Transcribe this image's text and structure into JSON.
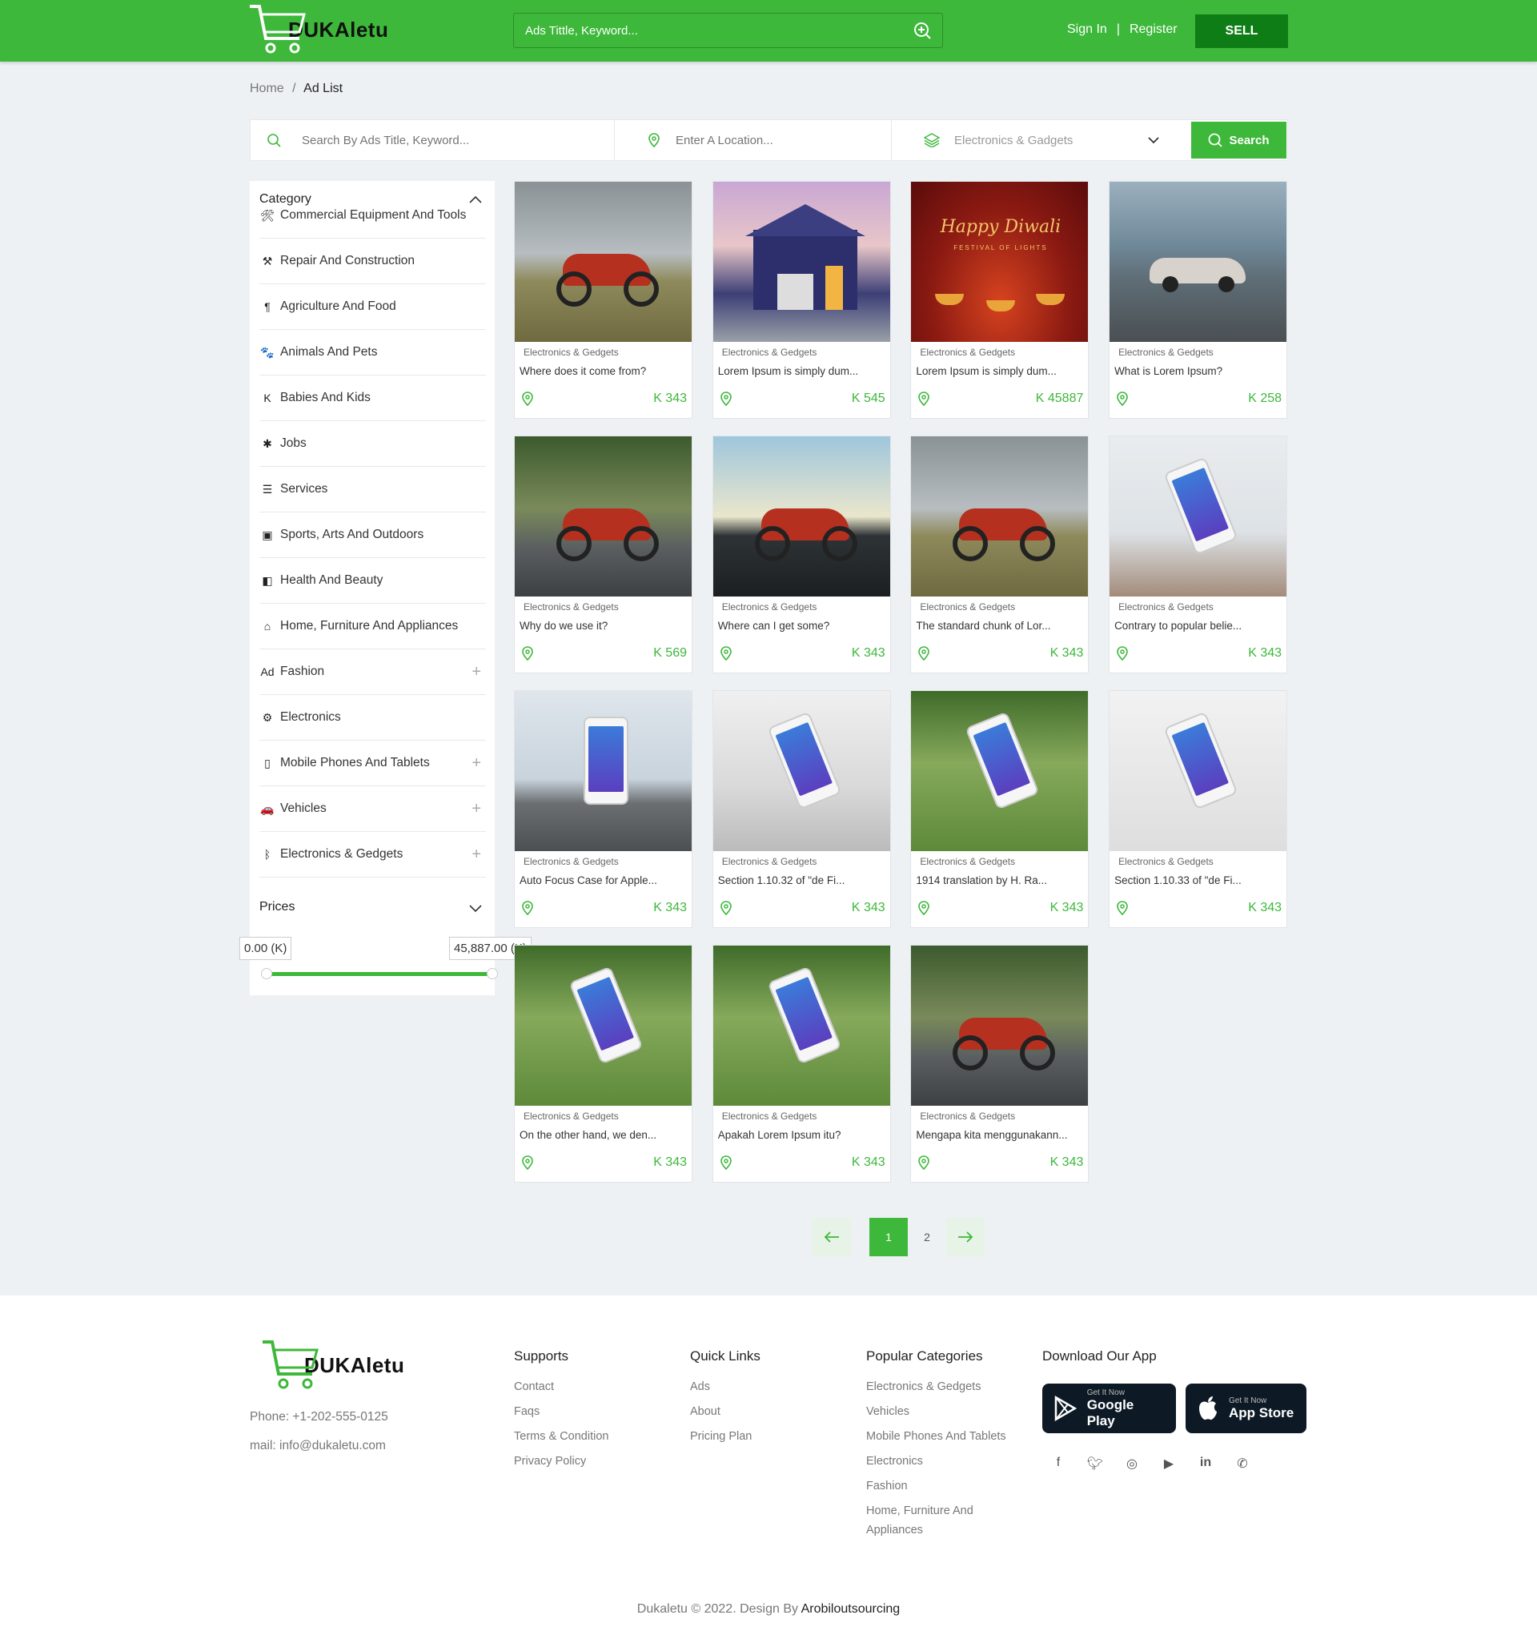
{
  "brand": {
    "logo_text": "DUKAletu"
  },
  "header": {
    "search_placeholder": "Ads Tittle, Keyword...",
    "sign_in": "Sign In",
    "separator": "|",
    "register": "Register",
    "sell": "SELL",
    "accent_color": "#3db83a",
    "sell_color": "#0f7d16"
  },
  "breadcrumb": {
    "home": "Home",
    "separator": "/",
    "current": "Ad List"
  },
  "filter": {
    "keyword_placeholder": "Search By Ads Title, Keyword...",
    "location_placeholder": "Enter A Location...",
    "category_value": "Electronics & Gadgets",
    "search_button": "Search"
  },
  "sidebar": {
    "category_title": "Category",
    "categories": [
      {
        "label": "Commercial Equipment And Tools",
        "icon": "🛠",
        "expandable": false
      },
      {
        "label": "Repair And Construction",
        "icon": "⚒",
        "expandable": false
      },
      {
        "label": "Agriculture And Food",
        "icon": "¶",
        "expandable": false
      },
      {
        "label": "Animals And Pets",
        "icon": "🐾",
        "expandable": false
      },
      {
        "label": "Babies And Kids",
        "icon": "K",
        "expandable": false
      },
      {
        "label": "Jobs",
        "icon": "✱",
        "expandable": false
      },
      {
        "label": "Services",
        "icon": "☰",
        "expandable": false
      },
      {
        "label": "Sports, Arts And Outdoors",
        "icon": "▣",
        "expandable": false
      },
      {
        "label": "Health And Beauty",
        "icon": "◧",
        "expandable": false
      },
      {
        "label": "Home, Furniture And Appliances",
        "icon": "⌂",
        "expandable": false
      },
      {
        "label": "Fashion",
        "icon": "Ad",
        "expandable": true
      },
      {
        "label": "Electronics",
        "icon": "⚙",
        "expandable": false
      },
      {
        "label": "Mobile Phones And Tablets",
        "icon": "▯",
        "expandable": true
      },
      {
        "label": "Vehicles",
        "icon": "🚗",
        "expandable": true
      },
      {
        "label": "Electronics & Gedgets",
        "icon": "ᛒ",
        "expandable": true
      }
    ],
    "prices_title": "Prices",
    "price_min": "0.00 (K)",
    "price_max": "45,887.00 (K)",
    "price_range_fraction": [
      0.0,
      1.0
    ]
  },
  "ads": [
    {
      "category": "Electronics & Gedgets",
      "title": "Where does it come from?",
      "price": "K 343",
      "image": "motorbike-field"
    },
    {
      "category": "Electronics & Gedgets",
      "title": "Lorem Ipsum is simply dum...",
      "price": "K 545",
      "image": "house"
    },
    {
      "category": "Electronics & Gedgets",
      "title": "Lorem Ipsum is simply dum...",
      "price": "K 45887",
      "image": "diwali",
      "image_text": "Happy Diwali",
      "image_subtext": "FESTIVAL OF LIGHTS"
    },
    {
      "category": "Electronics & Gedgets",
      "title": "What is Lorem Ipsum?",
      "price": "K 258",
      "image": "car"
    },
    {
      "category": "Electronics & Gedgets",
      "title": "Why do we use it?",
      "price": "K 569",
      "image": "sportbike"
    },
    {
      "category": "Electronics & Gedgets",
      "title": "Where can I get some?",
      "price": "K 343",
      "image": "cruiser-sunset"
    },
    {
      "category": "Electronics & Gedgets",
      "title": "The standard chunk of Lor...",
      "price": "K 343",
      "image": "motorbike-field"
    },
    {
      "category": "Electronics & Gedgets",
      "title": "Contrary to popular belie...",
      "price": "K 343",
      "image": "phone-hand-snow"
    },
    {
      "category": "Electronics & Gedgets",
      "title": "Auto Focus Case for Apple...",
      "price": "K 343",
      "image": "phone-table"
    },
    {
      "category": "Electronics & Gedgets",
      "title": "Section 1.10.32 of \"de Fi...",
      "price": "K 343",
      "image": "iphone-laptop"
    },
    {
      "category": "Electronics & Gedgets",
      "title": "1914 translation by H. Ra...",
      "price": "K 343",
      "image": "phone-hand-green"
    },
    {
      "category": "Electronics & Gedgets",
      "title": "Section 1.10.33 of \"de Fi...",
      "price": "K 343",
      "image": "phone-white"
    },
    {
      "category": "Electronics & Gedgets",
      "title": "On the other hand, we den...",
      "price": "K 343",
      "image": "phone-hand-green"
    },
    {
      "category": "Electronics & Gedgets",
      "title": "Apakah Lorem Ipsum itu?",
      "price": "K 343",
      "image": "phone-hand-green"
    },
    {
      "category": "Electronics & Gedgets",
      "title": "Mengapa kita menggunakann...",
      "price": "K 343",
      "image": "sportbike"
    }
  ],
  "pagination": {
    "pages": [
      "1",
      "2"
    ],
    "current": "1"
  },
  "footer": {
    "phone": "Phone: +1-202-555-0125",
    "mail": "mail: info@dukaletu.com",
    "supports_title": "Supports",
    "supports": [
      "Contact",
      "Faqs",
      "Terms & Condition",
      "Privacy Policy"
    ],
    "quick_title": "Quick Links",
    "quick": [
      "Ads",
      "About",
      "Pricing Plan"
    ],
    "popular_title": "Popular Categories",
    "popular": [
      "Electronics & Gedgets",
      "Vehicles",
      "Mobile Phones And Tablets",
      "Electronics",
      "Fashion",
      "Home, Furniture And Appliances"
    ],
    "app_title": "Download Our App",
    "google_small": "Get It Now",
    "google_big": "Google Play",
    "apple_small": "Get It Now",
    "apple_big": "App Store",
    "social": [
      "facebook-icon",
      "twitter-icon",
      "instagram-icon",
      "youtube-icon",
      "linkedin-icon",
      "whatsapp-icon"
    ],
    "copyright": "Dukaletu © 2022. Design By",
    "designer": "Arobiloutsourcing"
  }
}
